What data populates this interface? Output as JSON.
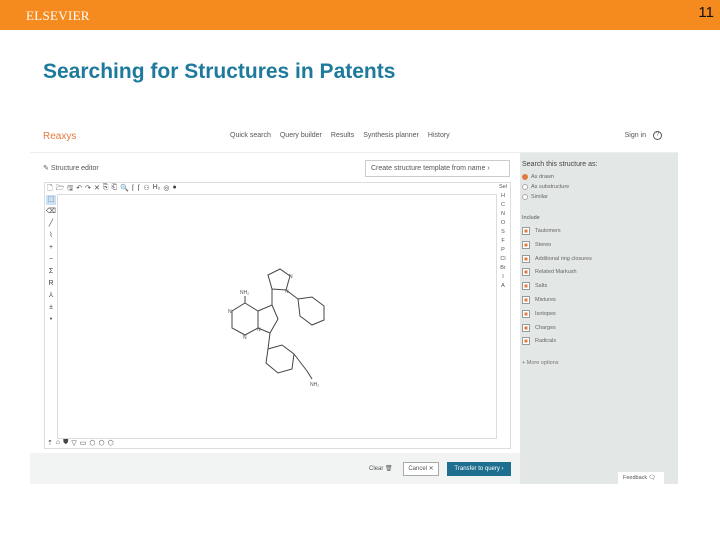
{
  "header": {
    "publisher": "ELSEVIER",
    "page_number": "11"
  },
  "slide_title": "Searching for Structures in Patents",
  "app": {
    "brand": "Reaxys",
    "nav": [
      "Quick search",
      "Query builder",
      "Results",
      "Synthesis planner",
      "History"
    ],
    "sign_in": "Sign in",
    "help": "?",
    "structure_editor": "Structure editor",
    "template_button": "Create structure template from name  ›",
    "toolbar_top": [
      "🗋",
      "🗁",
      "🖫",
      "↶",
      "↷",
      "✕",
      "⎘",
      "⎗",
      "🔍",
      "⌈",
      "⌈",
      "⚇",
      "H₂",
      "◎",
      "●"
    ],
    "toolbar_left": [
      "⬚",
      "⌫",
      "╱",
      "⌇",
      "+",
      "−",
      "Σ",
      "R",
      "⅄",
      "±",
      "•"
    ],
    "toolbar_right": [
      "Sel",
      "H",
      "C",
      "N",
      "O",
      "S",
      "F",
      "P",
      "Cl",
      "Br",
      "I",
      "A"
    ],
    "toolbar_bottom": [
      "⇡",
      "⌂",
      "⛊",
      "▽",
      "▭",
      "⬡",
      "⬡",
      "⬡"
    ],
    "atom_labels": {
      "nh2_top": "NH₂",
      "n1": "N",
      "n2": "N",
      "n3": "N",
      "n_pz1": "N",
      "n_pz2": "N",
      "nh2_bottom": "NH₂"
    },
    "search_as": {
      "title": "Search this structure as:",
      "options": [
        {
          "label": "As drawn",
          "selected": true
        },
        {
          "label": "As substructure",
          "selected": false
        },
        {
          "label": "Similar",
          "selected": false
        }
      ]
    },
    "include": {
      "title": "Include",
      "items": [
        "Tautomers",
        "Stereo",
        "Additional ring closures",
        "Related Markush",
        "Salts",
        "Mixtures",
        "Isotopes",
        "Charges",
        "Radicals"
      ]
    },
    "more_options": "+ More options",
    "footer": {
      "clear": "Clear 🗑",
      "cancel": "Cancel  ✕",
      "transfer": "Transfer to query  ›"
    },
    "feedback": "Feedback 🗨"
  }
}
